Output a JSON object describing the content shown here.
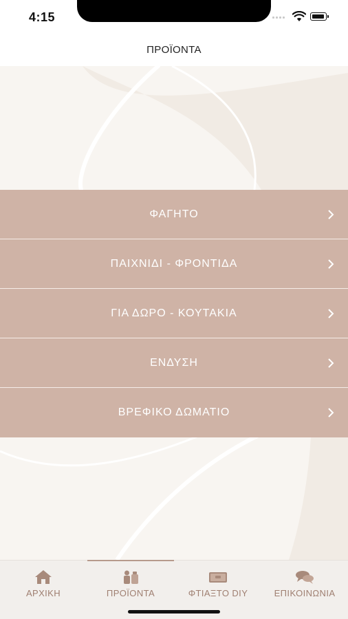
{
  "status_bar": {
    "time": "4:15"
  },
  "nav": {
    "title": "ΠΡΟΪΟΝΤΑ"
  },
  "menu": {
    "items": [
      {
        "label": "ΦΑΓΗΤΟ"
      },
      {
        "label": "ΠΑΙΧΝΙΔΙ - ΦΡΟΝΤΙΔΑ"
      },
      {
        "label": "ΓΙΑ ΔΩΡΟ - ΚΟΥΤΑΚΙΑ"
      },
      {
        "label": "ΕΝΔΥΣΗ"
      },
      {
        "label": "ΒΡΕΦΙΚΟ ΔΩΜΑΤΙΟ"
      }
    ]
  },
  "tab_bar": {
    "tabs": [
      {
        "label": "ΑΡΧΙΚΗ",
        "icon": "home-icon"
      },
      {
        "label": "ΠΡΟΪΟΝΤΑ",
        "icon": "products-icon"
      },
      {
        "label": "ΦΤΙΑΞΤΟ DIY",
        "icon": "diy-icon"
      },
      {
        "label": "ΕΠΙΚΟΙΝΩΝΙΑ",
        "icon": "chat-icon"
      }
    ],
    "active_tab": "ΠΡΟΪΟΝΤΑ"
  },
  "colors": {
    "accent": "#cfb3a6",
    "tab_text": "#9f7f71",
    "background": "#f8f5f1"
  }
}
